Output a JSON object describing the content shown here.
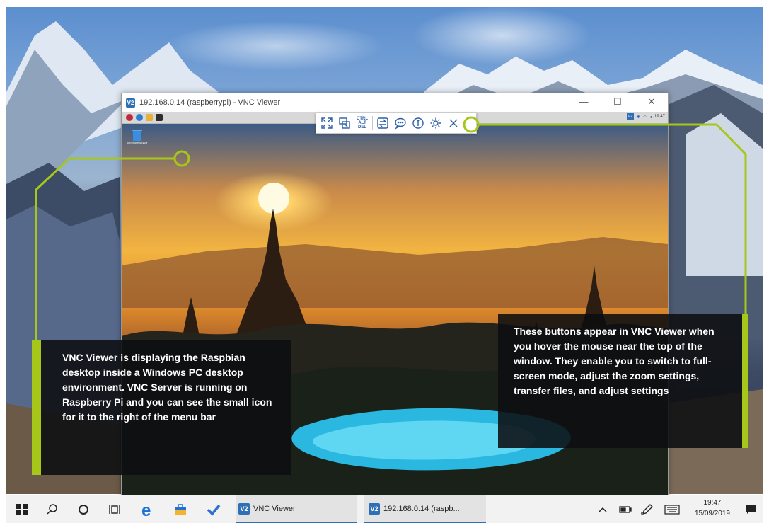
{
  "vnc_window": {
    "title": "192.168.0.14 (raspberrypi) - VNC Viewer",
    "logo": "V2",
    "controls": {
      "minimize": "—",
      "maximize": "☐",
      "close": "✕"
    }
  },
  "pi_desktop": {
    "trash_label": "Wastebasket",
    "tray_time": "19:47"
  },
  "toolbar": {
    "buttons": [
      {
        "name": "fullscreen",
        "icon": "expand-icon"
      },
      {
        "name": "scale",
        "icon": "scale-icon"
      },
      {
        "name": "ctrl-alt-del",
        "label": "CTRL ALT DEL"
      },
      {
        "name": "file-transfer",
        "icon": "transfer-icon"
      },
      {
        "name": "chat",
        "icon": "chat-icon"
      },
      {
        "name": "info",
        "icon": "info-icon"
      },
      {
        "name": "settings",
        "icon": "gear-icon"
      },
      {
        "name": "close",
        "icon": "close-icon"
      }
    ]
  },
  "callouts": {
    "left": "VNC Viewer is displaying the Raspbian desktop inside a Windows PC desktop environment. VNC Server is running on Raspberry Pi and you can see the small icon for it to the right of the menu bar",
    "right": "These buttons appear in VNC Viewer when you hover the mouse near the top of the window. They enable you to switch to full-screen mode, adjust the zoom settings, transfer files, and adjust settings"
  },
  "taskbar": {
    "app1_label": "VNC Viewer",
    "app2_label": "192.168.0.14 (raspb...",
    "app_logo": "V2",
    "time": "19:47",
    "date": "15/09/2019"
  },
  "colors": {
    "accent": "#a6c71a",
    "vnc_blue": "#2e6fb5"
  }
}
